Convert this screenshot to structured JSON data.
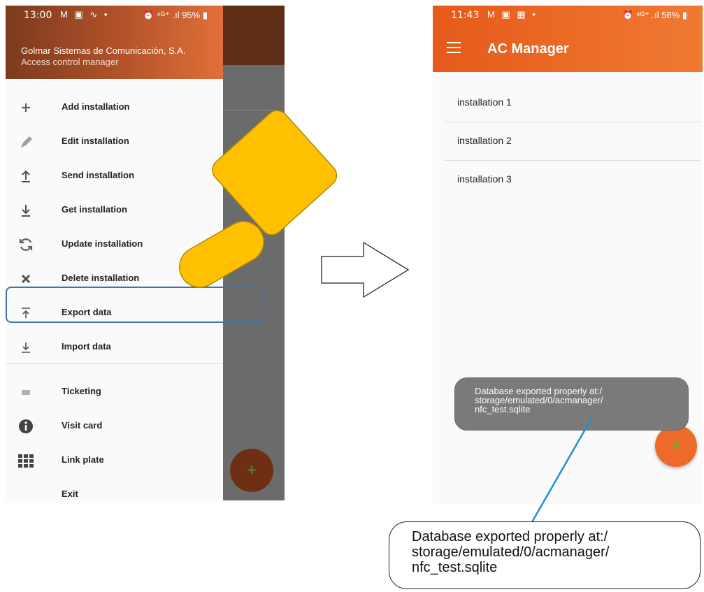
{
  "left_phone": {
    "status": {
      "time": "13:00",
      "left_icons": "M ▣ ∿ •",
      "right_icons": "⏰ ⁴ᴳ⁺ .ıl 95% ▮"
    },
    "drawer": {
      "company": "Golmar Sistemas de Comunicación, S.A.",
      "subtitle": "Access control manager",
      "items": [
        {
          "label": "Add installation",
          "icon": "plus-icon"
        },
        {
          "label": "Edit installation",
          "icon": "pencil-icon"
        },
        {
          "label": "Send installation",
          "icon": "upload-icon"
        },
        {
          "label": "Get installation",
          "icon": "download-icon"
        },
        {
          "label": "Update installation",
          "icon": "refresh-icon"
        },
        {
          "label": "Delete installation",
          "icon": "close-icon"
        },
        {
          "label": "Export data",
          "icon": "export-icon"
        },
        {
          "label": "Import data",
          "icon": "import-icon"
        }
      ],
      "secondary_items": [
        {
          "label": "Ticketing",
          "icon": "ticket-icon"
        },
        {
          "label": "Visit card",
          "icon": "info-icon"
        },
        {
          "label": "Link plate",
          "icon": "grid-icon"
        },
        {
          "label": "Exit",
          "icon": ""
        }
      ]
    },
    "fab_symbol": "+"
  },
  "right_phone": {
    "status": {
      "time": "11:43",
      "left_icons": "M ▣ ▦ •",
      "right_icons": "⏰ ⁴ᴳ⁺ .ıl 58% ▮"
    },
    "app_title": "AC Manager",
    "installations": [
      "installation 1",
      "installation 2",
      "installation 3"
    ],
    "toast_lines": [
      "Database exported properly at:/",
      "storage/emulated/0/acmanager/",
      "nfc_test.sqlite"
    ],
    "fab_symbol": "+"
  },
  "callout_lines": [
    "Database exported properly at:/",
    "storage/emulated/0/acmanager/",
    "nfc_test.sqlite"
  ],
  "colors": {
    "accent": "#f07a33",
    "drawer_header_dark": "#7c3a1d",
    "hand": "#ffc000",
    "highlight": "#4472a8",
    "pointer_line": "#1f8fd6"
  }
}
